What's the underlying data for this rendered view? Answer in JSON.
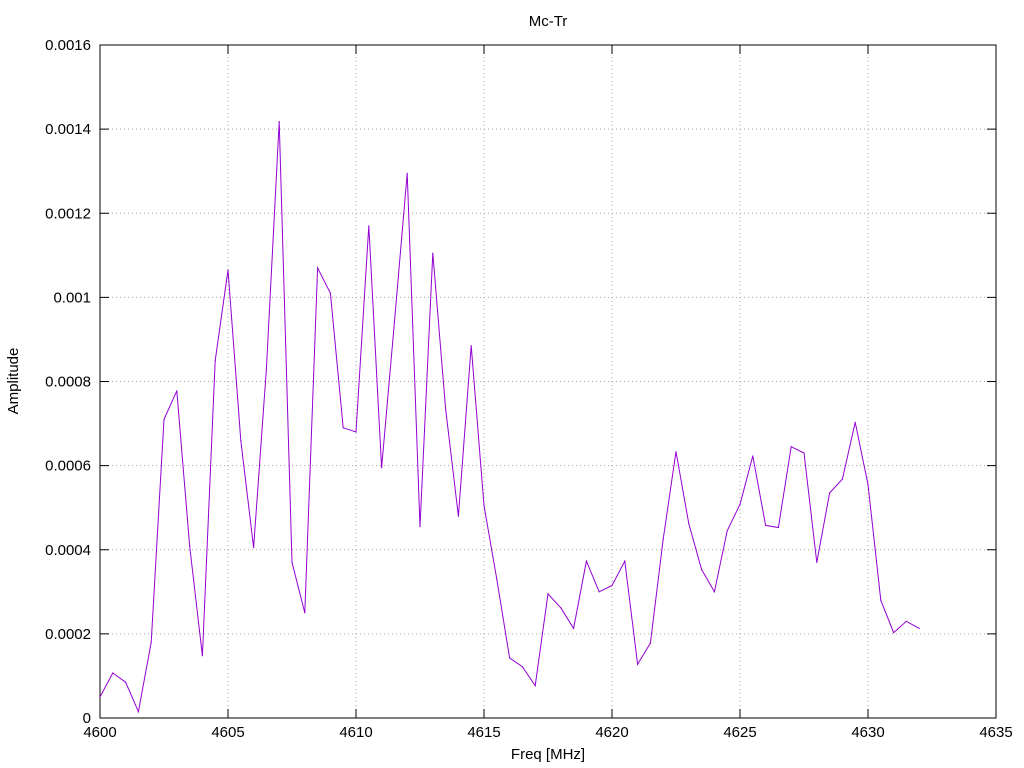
{
  "chart_data": {
    "type": "line",
    "title": "Mc-Tr",
    "xlabel": "Freq [MHz]",
    "ylabel": "Amplitude",
    "xlim": [
      4600,
      4635
    ],
    "ylim": [
      0,
      0.0016
    ],
    "xticks": [
      "4600",
      "4605",
      "4610",
      "4615",
      "4620",
      "4625",
      "4630",
      "4635"
    ],
    "yticks": [
      "0",
      "0.0002",
      "0.0004",
      "0.0006",
      "0.0008",
      "0.001",
      "0.0012",
      "0.0014",
      "0.0016"
    ],
    "grid": true,
    "legend": "none",
    "series": [
      {
        "color": "#9400d3",
        "x": [
          4600,
          4600.5,
          4601,
          4601.5,
          4602,
          4602.5,
          4603,
          4603.5,
          4604,
          4604.5,
          4605,
          4605.5,
          4606,
          4606.5,
          4607,
          4607.5,
          4608,
          4608.5,
          4609,
          4609.5,
          4610,
          4610.5,
          4611,
          4611.5,
          4612,
          4612.5,
          4613,
          4613.5,
          4614,
          4614.5,
          4615,
          4615.5,
          4616,
          4616.5,
          4617,
          4617.5,
          4618,
          4618.5,
          4619,
          4619.5,
          4620,
          4620.5,
          4621,
          4621.5,
          4622,
          4622.5,
          4623,
          4623.5,
          4624,
          4624.5,
          4625,
          4625.5,
          4626,
          4626.5,
          4627,
          4627.5,
          4628,
          4628.5,
          4629,
          4629.5,
          4630,
          4630.5,
          4631,
          4631.5,
          4632
        ],
        "y": [
          5e-05,
          0.000107,
          8.5e-05,
          1.5e-05,
          0.00018,
          0.00071,
          0.000778,
          0.00041,
          0.000148,
          0.00085,
          0.001065,
          0.00066,
          0.000405,
          0.00083,
          0.001418,
          0.00037,
          0.00025,
          0.00107,
          0.00101,
          0.00069,
          0.00068,
          0.00117,
          0.000595,
          0.00094,
          0.001295,
          0.000455,
          0.001105,
          0.000735,
          0.00048,
          0.000885,
          0.000505,
          0.00033,
          0.000143,
          0.000122,
          7.7e-05,
          0.000295,
          0.000262,
          0.000213,
          0.000373,
          0.0003,
          0.000315,
          0.000373,
          0.000128,
          0.000178,
          0.000425,
          0.000633,
          0.000462,
          0.000353,
          0.0003,
          0.000445,
          0.000508,
          0.000623,
          0.000458,
          0.000453,
          0.000645,
          0.00063,
          0.00037,
          0.000535,
          0.000568,
          0.000703,
          0.000555,
          0.00028,
          0.000203,
          0.00023,
          0.000213
        ]
      }
    ]
  }
}
